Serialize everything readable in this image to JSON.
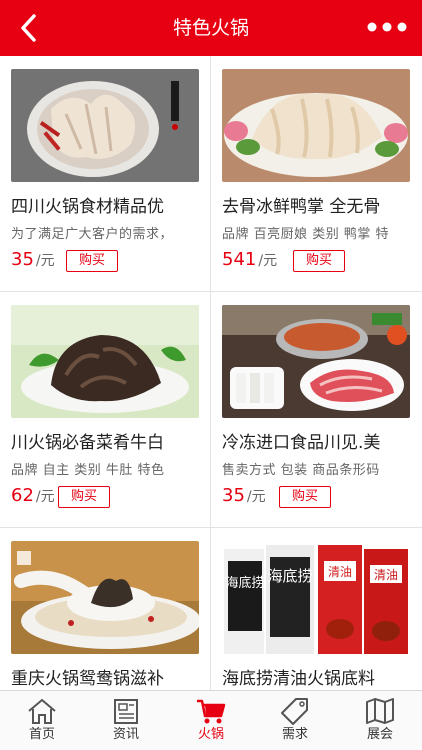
{
  "header": {
    "title": "特色火锅",
    "back_icon": "back-chevron-icon",
    "more_icon": "more-dots-icon"
  },
  "products": [
    {
      "name": "四川火锅食材精品优",
      "desc": "为了满足广大客户的需求，",
      "price": "35",
      "unit": "/元",
      "buy": "购买",
      "image": "sliced-tripe-on-plate"
    },
    {
      "name": "去骨冰鲜鸭掌 全无骨",
      "desc": "品牌 百亮厨娘 类别 鸭掌 特",
      "price": "541",
      "unit": "/元",
      "buy": "购买",
      "image": "goose-intestine-on-plate"
    },
    {
      "name": "川火锅必备菜肴牛白",
      "desc": "品牌 自主 类别 牛肚 特色",
      "price": "62",
      "unit": "/元",
      "buy": "购买",
      "image": "beef-tripe-on-plate"
    },
    {
      "name": "冷冻进口食品川见.美",
      "desc": "售卖方式 包装 商品条形码",
      "price": "35",
      "unit": "/元",
      "buy": "购买",
      "image": "hotpot-table-spread"
    },
    {
      "name": "重庆火锅鸳鸯锅滋补",
      "desc": "",
      "price": "",
      "unit": "",
      "buy": "",
      "image": "soup-spoon-broth"
    },
    {
      "name": "海底捞清油火锅底料",
      "desc": "",
      "price": "",
      "unit": "",
      "buy": "",
      "image": "haidilao-seasoning-packs"
    }
  ],
  "haidilao_pack_text": [
    "海底捞",
    "海底捞",
    "清油",
    "清油"
  ],
  "tabs": [
    {
      "label": "首页",
      "icon": "home-icon",
      "active": false
    },
    {
      "label": "资讯",
      "icon": "news-icon",
      "active": false
    },
    {
      "label": "火锅",
      "icon": "cart-icon",
      "active": true
    },
    {
      "label": "需求",
      "icon": "tag-icon",
      "active": false
    },
    {
      "label": "展会",
      "icon": "map-icon",
      "active": false
    }
  ],
  "colors": {
    "accent": "#e60012",
    "background": "#f2f2f2"
  }
}
